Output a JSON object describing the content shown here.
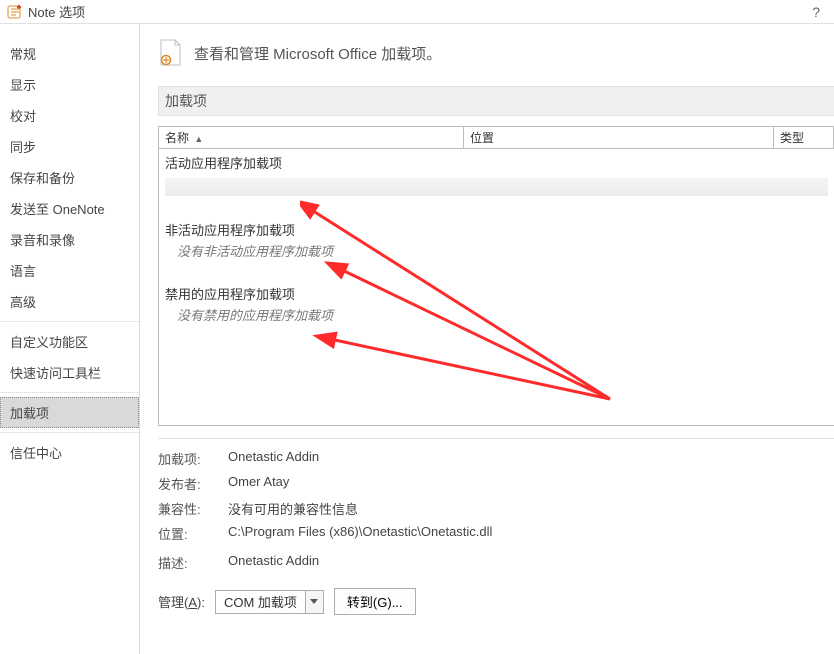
{
  "window": {
    "title": "Note 选项",
    "help": "?"
  },
  "sidebar": {
    "items": [
      "常规",
      "显示",
      "校对",
      "同步",
      "保存和备份",
      "发送至 OneNote",
      "录音和录像",
      "语言",
      "高级"
    ],
    "items2": [
      "自定义功能区",
      "快速访问工具栏"
    ],
    "items3": [
      "加载项"
    ],
    "items4": [
      "信任中心"
    ],
    "selected": "加载项"
  },
  "main": {
    "subtitle": "查看和管理 Microsoft Office 加载项。",
    "section_label": "加载项",
    "columns": {
      "name": "名称",
      "location": "位置",
      "type": "类型"
    },
    "groups": {
      "active": {
        "header": "活动应用程序加载项"
      },
      "inactive": {
        "header": "非活动应用程序加载项",
        "empty": "没有非活动应用程序加载项"
      },
      "disabled": {
        "header": "禁用的应用程序加载项",
        "empty": "没有禁用的应用程序加载项"
      }
    },
    "details": {
      "addin_label": "加载项:",
      "addin_value": "Onetastic Addin",
      "publisher_label": "发布者:",
      "publisher_value": "Omer Atay",
      "compat_label": "兼容性:",
      "compat_value": "没有可用的兼容性信息",
      "location_label": "位置:",
      "location_value": "C:\\Program Files (x86)\\Onetastic\\Onetastic.dll",
      "desc_label": "描述:",
      "desc_value": "Onetastic Addin"
    },
    "footer": {
      "manage_label_pre": "管理(",
      "manage_label_hot": "A",
      "manage_label_post": "):",
      "combo_value": "COM 加载项",
      "go_label": "转到(G)..."
    }
  }
}
